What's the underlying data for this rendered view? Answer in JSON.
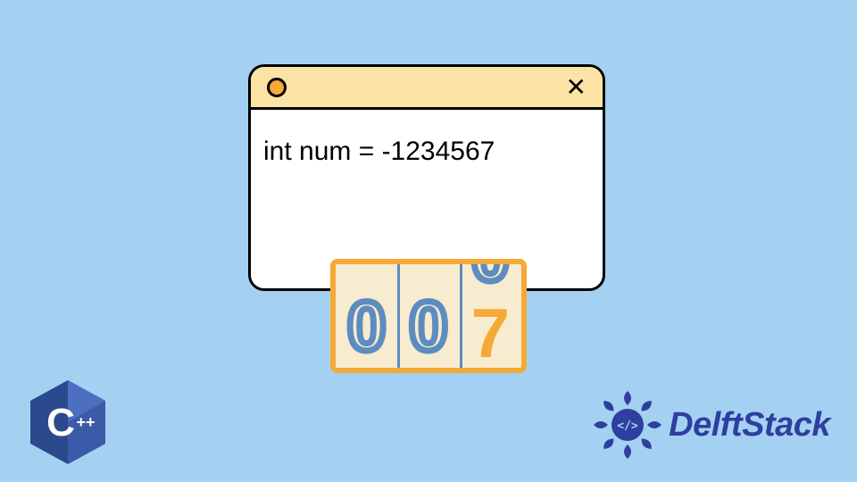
{
  "window": {
    "close_glyph": "✕",
    "code_line": "int num = -1234567"
  },
  "odometer": {
    "slot1": "0",
    "slot2": "0",
    "slot3_top": "0",
    "slot3_bottom": "7"
  },
  "cpp_logo": {
    "letter": "C",
    "plus": "++"
  },
  "brand": {
    "name": "DelftStack"
  }
}
